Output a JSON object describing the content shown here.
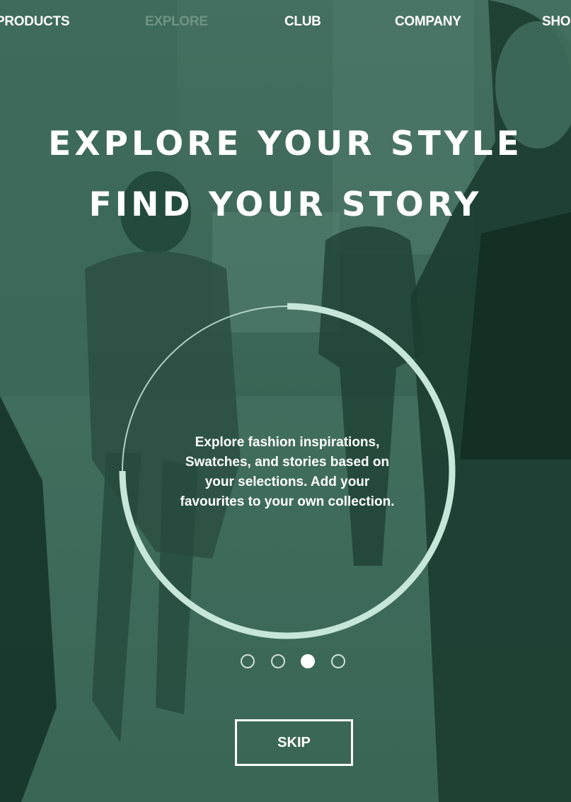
{
  "nav": {
    "items": [
      {
        "label": "PRODUCTS",
        "active": false
      },
      {
        "label": "EXPLORE",
        "active": true
      },
      {
        "label": "CLUB",
        "active": false
      },
      {
        "label": "COMPANY",
        "active": false
      },
      {
        "label": "SHO",
        "active": false
      }
    ]
  },
  "hero": {
    "line1": "EXPLORE YOUR STYLE",
    "line2": "FIND YOUR STORY"
  },
  "intro": {
    "lines": [
      "Explore fashion inspirations,",
      "Swatches, and stories based on",
      "your selections. Add your",
      "favourites to your own collection."
    ],
    "progress": 0.75
  },
  "pager": {
    "count": 4,
    "current": 3
  },
  "skip": {
    "label": "SKIP"
  },
  "colors": {
    "overlay": "#2f5e4c",
    "ring": "#c7e6da",
    "text": "#ffffff",
    "active_nav": "#6f9485"
  }
}
